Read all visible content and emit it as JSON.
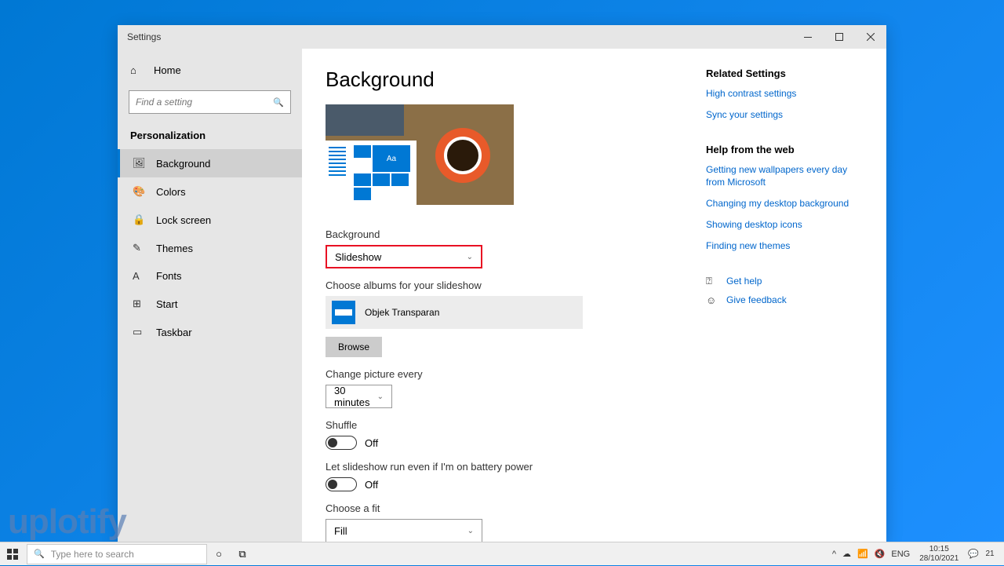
{
  "window": {
    "title": "Settings"
  },
  "sidebar": {
    "home": "Home",
    "search_placeholder": "Find a setting",
    "category": "Personalization",
    "items": [
      {
        "icon": "🖼",
        "label": "Background"
      },
      {
        "icon": "🎨",
        "label": "Colors"
      },
      {
        "icon": "🔒",
        "label": "Lock screen"
      },
      {
        "icon": "✎",
        "label": "Themes"
      },
      {
        "icon": "A",
        "label": "Fonts"
      },
      {
        "icon": "⊞",
        "label": "Start"
      },
      {
        "icon": "▭",
        "label": "Taskbar"
      }
    ]
  },
  "content": {
    "heading": "Background",
    "preview_aa": "Aa",
    "background_label": "Background",
    "background_value": "Slideshow",
    "albums_label": "Choose albums for your slideshow",
    "album_name": "Objek Transparan",
    "browse": "Browse",
    "change_every_label": "Change picture every",
    "change_every_value": "30 minutes",
    "shuffle_label": "Shuffle",
    "shuffle_state": "Off",
    "battery_label": "Let slideshow run even if I'm on battery power",
    "battery_state": "Off",
    "fit_label": "Choose a fit",
    "fit_value": "Fill"
  },
  "right": {
    "related_heading": "Related Settings",
    "related": [
      "High contrast settings",
      "Sync your settings"
    ],
    "help_heading": "Help from the web",
    "help": [
      "Getting new wallpapers every day from Microsoft",
      "Changing my desktop background",
      "Showing desktop icons",
      "Finding new themes"
    ],
    "get_help": "Get help",
    "feedback": "Give feedback"
  },
  "watermark": "uplotify",
  "taskbar": {
    "search": "Type here to search",
    "lang": "ENG",
    "time": "10:15",
    "date": "28/10/2021",
    "notifications": "21"
  }
}
